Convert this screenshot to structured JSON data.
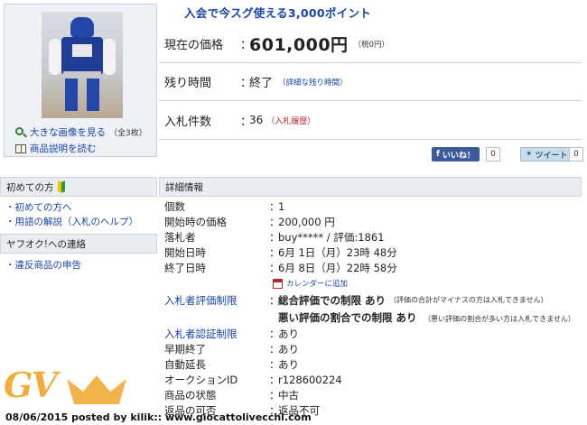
{
  "photo": {
    "links": [
      {
        "label": "大きな画像を見る",
        "count": "（全3枚）",
        "icon": "magnifier-icon"
      },
      {
        "label": "商品説明を読む",
        "icon": "book-icon"
      }
    ]
  },
  "promo": "入会で今スグ使える3,000ポイント",
  "summary": {
    "price_label": "現在の価格",
    "price_value": "601,000円",
    "price_tax": "（税0円）",
    "time_label": "残り時間",
    "time_value": "終了",
    "time_link": "（詳細な残り時間）",
    "bids_label": "入札件数",
    "bids_value": "36",
    "bids_link": "（入札履歴）",
    "colon": "："
  },
  "social": {
    "like_label": "いいね！",
    "like_count": "0",
    "tweet_label": "ツイート",
    "tweet_count": "0"
  },
  "sidebar": {
    "section1_title": "初めての方",
    "section1_items": [
      "・初めての方へ",
      "・用語の解説（入札のヘルプ）"
    ],
    "section2_title": "ヤフオク!への連絡",
    "section2_items": [
      "・違反商品の申告"
    ]
  },
  "details": {
    "title": "詳細情報",
    "rows": [
      {
        "label": "個数",
        "value": "1"
      },
      {
        "label": "開始時の価格",
        "value": "200,000 円"
      },
      {
        "label": "落札者",
        "value": "buy***** / 評価:1861"
      },
      {
        "label": "開始日時",
        "value": "6月 1日（月）23時 48分"
      },
      {
        "label": "終了日時",
        "value": "6月 8日（月）22時 58分"
      }
    ],
    "calendar_link": "カレンダーに追加",
    "restriction_label": "入札者評価制限",
    "restriction_value": "総合評価での制限 あり",
    "restriction_note": "（評価の合計がマイナスの方は入札できません）",
    "restriction2_value": "悪い評価の割合での制限 あり",
    "restriction2_note": "（悪い評価の割合が多い方は入札できません）",
    "rows2": [
      {
        "label": "入札者認証制限",
        "value": "あり",
        "link": true
      },
      {
        "label": "早期終了",
        "value": "あり"
      },
      {
        "label": "自動延長",
        "value": "あり"
      },
      {
        "label": "オークションID",
        "value": "r128600224"
      },
      {
        "label": "商品の状態",
        "value": "中古"
      },
      {
        "label": "返品の可否",
        "value": "返品不可"
      }
    ]
  },
  "watermark": {
    "logo": "GV",
    "footer": "08/06/2015 posted by kilik:: www.giocattolivecchi.com",
    "accent": "#f0a62a"
  }
}
